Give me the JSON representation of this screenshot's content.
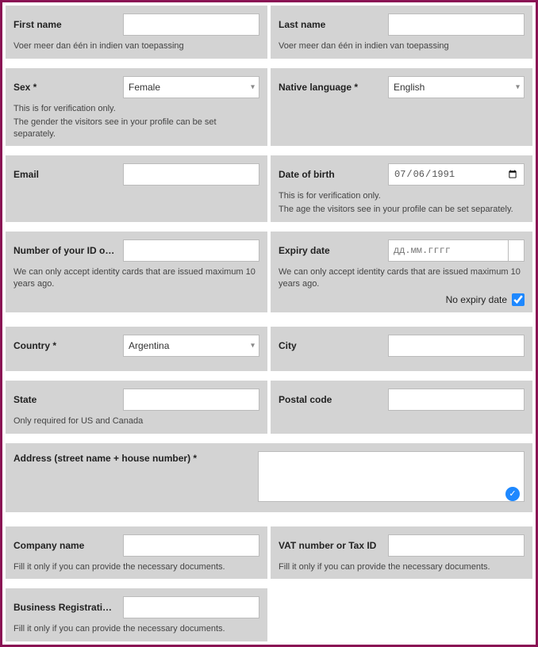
{
  "first_name": {
    "label": "First name",
    "value": "",
    "hint": "Voer meer dan één in indien van toepassing"
  },
  "last_name": {
    "label": "Last name",
    "value": "",
    "hint": "Voer meer dan één in indien van toepassing"
  },
  "sex": {
    "label": "Sex *",
    "value": "Female",
    "hint1": "This is for verification only.",
    "hint2": "The gender the visitors see in your profile can be set separately."
  },
  "native_language": {
    "label": "Native language *",
    "value": "English"
  },
  "email": {
    "label": "Email",
    "value": ""
  },
  "dob": {
    "label": "Date of birth",
    "value": "1991-07-06",
    "display": "06.07.1991",
    "hint1": "This is for verification only.",
    "hint2": "The age the visitors see in your profile can be set separately."
  },
  "id_number": {
    "label": "Number of your ID or p…",
    "value": "",
    "hint": "We can only accept identity cards that are issued maximum 10 years ago."
  },
  "expiry": {
    "label": "Expiry date",
    "placeholder": "дд.мм.гггг",
    "value": "",
    "hint": "We can only accept identity cards that are issued maximum 10 years ago.",
    "no_expiry_label": "No expiry date"
  },
  "country": {
    "label": "Country *",
    "value": "Argentina"
  },
  "city": {
    "label": "City",
    "value": ""
  },
  "state": {
    "label": "State",
    "value": "",
    "hint": "Only required for US and Canada"
  },
  "postal": {
    "label": "Postal code",
    "value": ""
  },
  "address": {
    "label": "Address (street name + house number) *",
    "value": ""
  },
  "company": {
    "label": "Company name",
    "value": "",
    "hint": "Fill it only if you can provide the necessary documents."
  },
  "vat": {
    "label": "VAT number or Tax ID",
    "value": "",
    "hint": "Fill it only if you can provide the necessary documents."
  },
  "business_reg": {
    "label": "Business Registration …",
    "value": "",
    "hint": "Fill it only if you can provide the necessary documents."
  }
}
